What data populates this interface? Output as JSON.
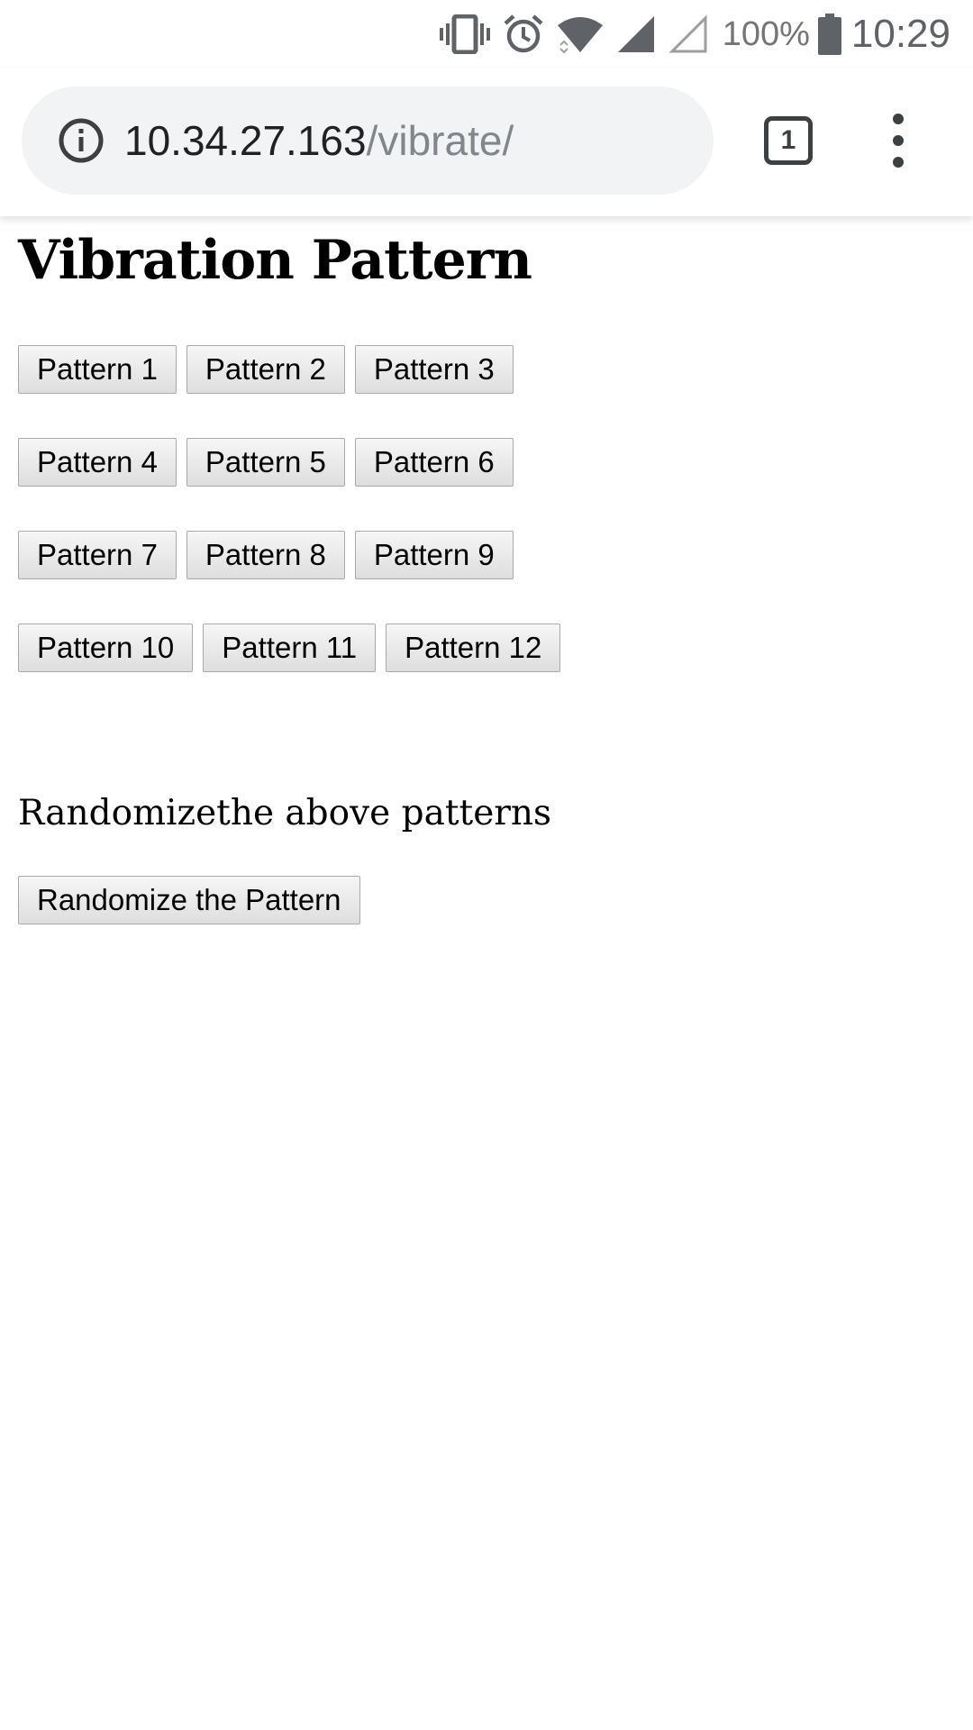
{
  "status_bar": {
    "icons": [
      "vibrate-icon",
      "alarm-icon",
      "wifi-icon",
      "cell-signal-icon",
      "cell-signal-empty-icon",
      "battery-icon"
    ],
    "battery_percent": "100%",
    "time": "10:29"
  },
  "browser": {
    "url_host": "10.34.27.163",
    "url_path": "/vibrate/",
    "tab_count": "1"
  },
  "page": {
    "title": "Vibration Pattern",
    "pattern_rows": [
      [
        "Pattern 1",
        "Pattern 2",
        "Pattern 3"
      ],
      [
        "Pattern 4",
        "Pattern 5",
        "Pattern 6"
      ],
      [
        "Pattern 7",
        "Pattern 8",
        "Pattern 9"
      ],
      [
        "Pattern 10",
        "Pattern 11",
        "Pattern 12"
      ]
    ],
    "randomize_text": "Randomizethe above patterns",
    "randomize_button": "Randomize the Pattern"
  }
}
